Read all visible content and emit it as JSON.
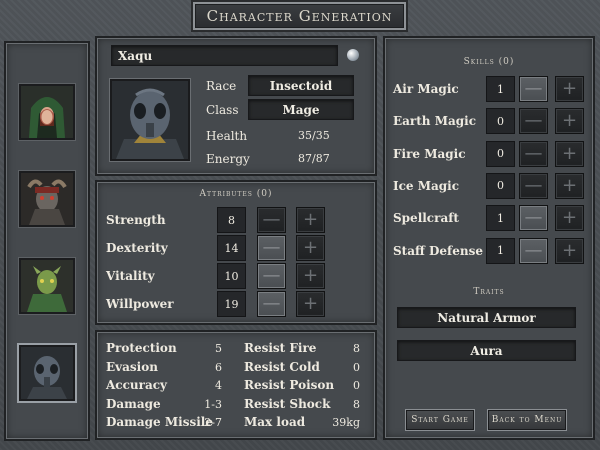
{
  "title": "Character Generation",
  "character": {
    "name": "Xaqu",
    "race_label": "Race",
    "race": "Insectoid",
    "class_label": "Class",
    "class": "Mage",
    "health_label": "Health",
    "health": "35/35",
    "energy_label": "Energy",
    "energy": "87/87"
  },
  "portraits": [
    {
      "name": "hooded-woman"
    },
    {
      "name": "horned-demon"
    },
    {
      "name": "lizardfolk"
    },
    {
      "name": "insectoid",
      "selected": true
    }
  ],
  "attributes": {
    "header": "Attributes (0)",
    "items": [
      {
        "label": "Strength",
        "value": "8",
        "minus_active": false
      },
      {
        "label": "Dexterity",
        "value": "14",
        "minus_active": true
      },
      {
        "label": "Vitality",
        "value": "10",
        "minus_active": true
      },
      {
        "label": "Willpower",
        "value": "19",
        "minus_active": true
      }
    ]
  },
  "stats": {
    "left": [
      {
        "label": "Protection",
        "value": "5"
      },
      {
        "label": "Evasion",
        "value": "6"
      },
      {
        "label": "Accuracy",
        "value": "4"
      },
      {
        "label": "Damage",
        "value": "1-3"
      },
      {
        "label": "Damage Missile",
        "value": "2-7"
      }
    ],
    "right": [
      {
        "label": "Resist Fire",
        "value": "8"
      },
      {
        "label": "Resist Cold",
        "value": "0"
      },
      {
        "label": "Resist Poison",
        "value": "0"
      },
      {
        "label": "Resist Shock",
        "value": "8"
      },
      {
        "label": "Max load",
        "value": "39kg"
      }
    ]
  },
  "skills": {
    "header": "Skills (0)",
    "items": [
      {
        "label": "Air Magic",
        "value": "1",
        "minus_active": true
      },
      {
        "label": "Earth Magic",
        "value": "0",
        "minus_active": false
      },
      {
        "label": "Fire Magic",
        "value": "0",
        "minus_active": false
      },
      {
        "label": "Ice Magic",
        "value": "0",
        "minus_active": false
      },
      {
        "label": "Spellcraft",
        "value": "1",
        "minus_active": true
      },
      {
        "label": "Staff Defense",
        "value": "1",
        "minus_active": true
      }
    ]
  },
  "traits": {
    "header": "Traits",
    "items": [
      "Natural Armor",
      "Aura"
    ]
  },
  "buttons": {
    "start": "Start Game",
    "back": "Back to Menu",
    "minus": "—",
    "plus": "+"
  },
  "colors": {
    "background": "#3c3f42",
    "panel": "#45494d",
    "dark_box": "#27292b",
    "text": "#eeeae0"
  }
}
